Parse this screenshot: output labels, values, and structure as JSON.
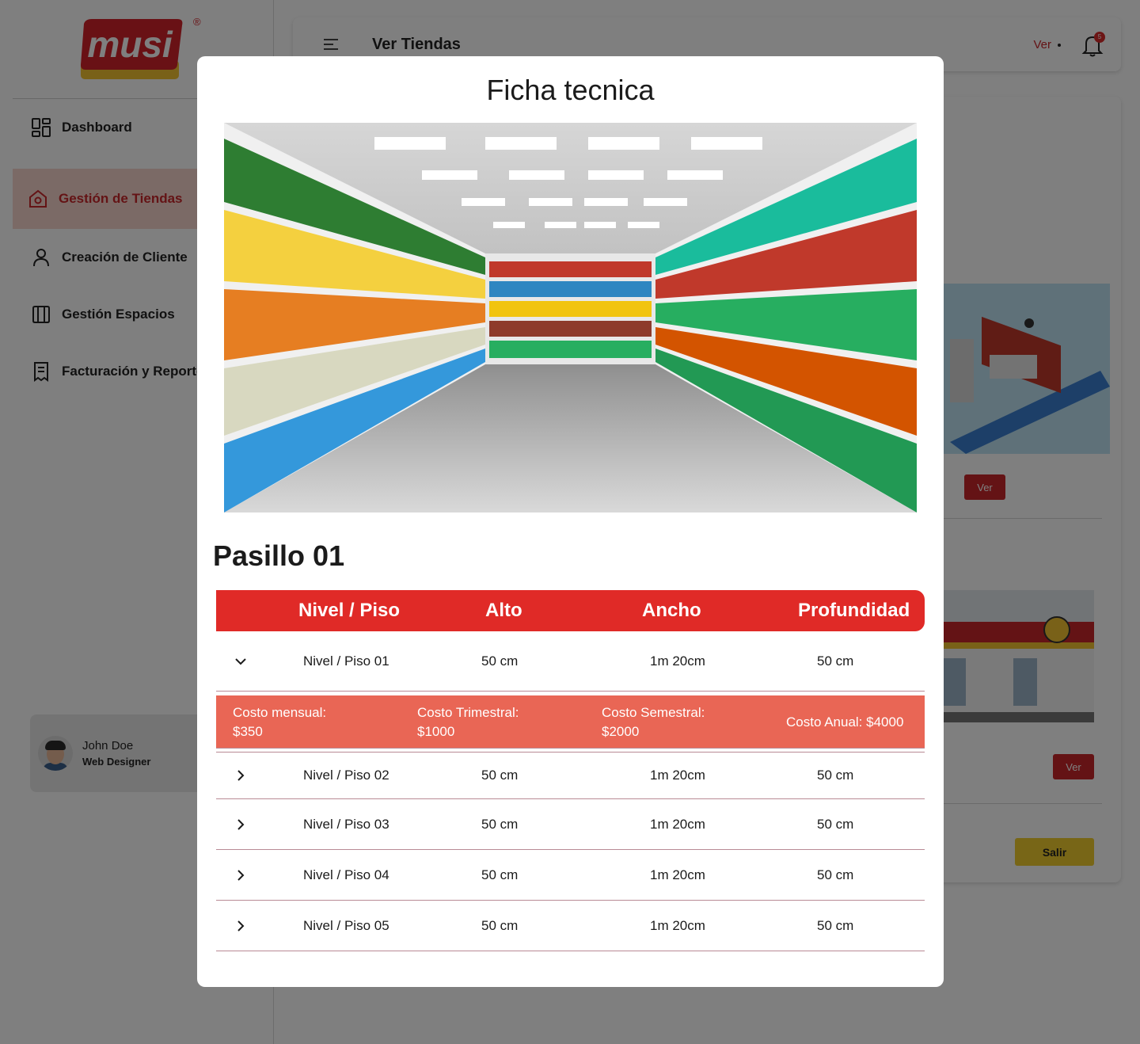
{
  "app": {
    "brand": "musi",
    "brand_mark": "®"
  },
  "sidebar": {
    "items": [
      {
        "label": "Dashboard",
        "icon": "dashboard-icon"
      },
      {
        "label": "Gestión de Tiendas",
        "icon": "store-icon",
        "active": true
      },
      {
        "label": "Creación de Cliente",
        "icon": "user-icon"
      },
      {
        "label": "Gestión Espacios",
        "icon": "map-icon"
      },
      {
        "label": "Facturación y Reportes",
        "icon": "receipt-icon"
      }
    ],
    "profile": {
      "name": "John Doe",
      "role": "Web Designer"
    }
  },
  "topbar": {
    "title": "Ver Tiendas",
    "ver_label": "Ver",
    "notification_count": "5"
  },
  "background": {
    "ver_button_1": "Ver",
    "ver_button_2": "Ver",
    "exit_button": "Salir"
  },
  "modal": {
    "title": "Ficha tecnica",
    "aisle_title": "Pasillo 01",
    "table": {
      "headers": [
        "Nivel / Piso",
        "Alto",
        "Ancho",
        "Profundidad"
      ],
      "rows": [
        {
          "level": "Nivel / Piso 01",
          "alto": "50 cm",
          "ancho": "1m 20cm",
          "profundidad": "50 cm",
          "expanded": true
        },
        {
          "level": "Nivel / Piso 02",
          "alto": "50 cm",
          "ancho": "1m 20cm",
          "profundidad": "50 cm",
          "expanded": false
        },
        {
          "level": "Nivel / Piso 03",
          "alto": "50 cm",
          "ancho": "1m 20cm",
          "profundidad": "50 cm",
          "expanded": false
        },
        {
          "level": "Nivel / Piso 04",
          "alto": "50 cm",
          "ancho": "1m 20cm",
          "profundidad": "50 cm",
          "expanded": false
        },
        {
          "level": "Nivel / Piso 05",
          "alto": "50 cm",
          "ancho": "1m 20cm",
          "profundidad": "50 cm",
          "expanded": false
        }
      ],
      "costs": {
        "mensual_label": "Costo mensual:",
        "mensual_value": "$350",
        "trimestral_label": "Costo Trimestral:",
        "trimestral_value": "$1000",
        "semestral_label": "Costo Semestral:",
        "semestral_value": "$2000",
        "anual": "Costo Anual: $4000"
      }
    }
  },
  "colors": {
    "brand_red": "#e02a27",
    "cost_row": "#e96655",
    "active_nav_bg": "#f6d5cd",
    "active_nav_text": "#c8262a",
    "exit_button": "#f0cc2f"
  }
}
